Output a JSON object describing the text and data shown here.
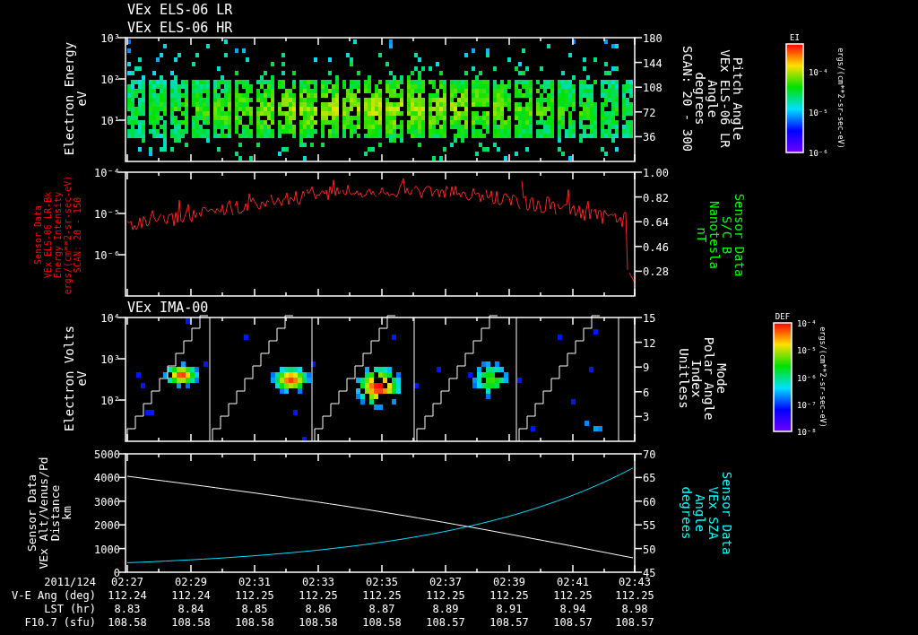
{
  "panels": [
    {
      "kind": "spectrogram",
      "titles": [
        "VEx ELS-06 LR",
        "VEx ELS-06 HR"
      ],
      "left_ticks": [
        "10³",
        "10²",
        "10¹"
      ],
      "right_ticks": [
        "180",
        "144",
        "108",
        "72",
        "36"
      ],
      "left_label": {
        "lines": [
          "Electron Energy",
          "eV"
        ],
        "color": "#ffffff"
      },
      "right_label": {
        "lines": [
          "Pitch Angle",
          "VEx ELS-06 LR",
          "Angle",
          "degrees",
          "SCAN: 20 - 300"
        ],
        "color": "#ffffff"
      },
      "colorbar": {
        "label": "EI",
        "ticks": [
          "10⁻⁴",
          "10⁻⁵",
          "10⁻⁶"
        ],
        "units": "ergs/(cm**2-sr-sec-eV)"
      }
    },
    {
      "kind": "line",
      "left_ticks": [
        "10⁻⁴",
        "10⁻⁵",
        "10⁻⁶"
      ],
      "right_ticks": [
        "1.00",
        "0.82",
        "0.64",
        "0.46",
        "0.28"
      ],
      "left_label": {
        "lines": [
          "Sensor Data",
          "VEx ELS-06 LR-Bk",
          "Energy Intensity",
          "ergs/(cm**2-sr-sec-eV)",
          "SCAN: 20 - 150"
        ],
        "color": "#ff0000"
      },
      "right_label": {
        "lines": [
          "Sensor Data",
          "S/C B",
          "Nanotesla",
          "nT"
        ],
        "color": "#00ff00"
      }
    },
    {
      "kind": "sweep",
      "titles": [
        "VEx IMA-00"
      ],
      "left_ticks": [
        "10⁴",
        "10³",
        "10²"
      ],
      "right_ticks": [
        "15",
        "12",
        "9",
        "6",
        "3"
      ],
      "left_label": {
        "lines": [
          "Electron Volts",
          "eV"
        ],
        "color": "#ffffff"
      },
      "right_label": {
        "lines": [
          "Mode",
          "Polar Angle",
          "Index",
          "Unitless"
        ],
        "color": "#ffffff"
      },
      "colorbar": {
        "label": "DEF",
        "ticks": [
          "10⁻⁴",
          "10⁻⁵",
          "10⁻⁶",
          "10⁻⁷",
          "10⁻⁸"
        ],
        "units": "ergs/(cm**2-sr-sec-eV)"
      }
    },
    {
      "kind": "lines",
      "left_ticks": [
        "5000",
        "4000",
        "3000",
        "2000",
        "1000",
        "0"
      ],
      "right_ticks": [
        "70",
        "65",
        "60",
        "55",
        "50",
        "45"
      ],
      "left_label": {
        "lines": [
          "Sensor Data",
          "VEx Alt/Venus/Pd",
          "Distance",
          "km"
        ],
        "color": "#ffffff"
      },
      "right_label": {
        "lines": [
          "Sensor Data",
          "VEx SZA",
          "Angle",
          "degrees"
        ],
        "color": "#00ffff"
      }
    }
  ],
  "time_axis": [
    {
      "label": "2011/124",
      "values": [
        "02:27",
        "02:29",
        "02:31",
        "02:33",
        "02:35",
        "02:37",
        "02:39",
        "02:41",
        "02:43"
      ]
    },
    {
      "label": "V-E Ang (deg)",
      "values": [
        "112.24",
        "112.24",
        "112.25",
        "112.25",
        "112.25",
        "112.25",
        "112.25",
        "112.25",
        "112.25"
      ]
    },
    {
      "label": "LST (hr)",
      "values": [
        "8.83",
        "8.84",
        "8.85",
        "8.86",
        "8.87",
        "8.89",
        "8.91",
        "8.94",
        "8.98"
      ]
    },
    {
      "label": "F10.7 (sfu)",
      "values": [
        "108.58",
        "108.58",
        "108.58",
        "108.58",
        "108.58",
        "108.57",
        "108.57",
        "108.57",
        "108.57"
      ]
    }
  ]
}
